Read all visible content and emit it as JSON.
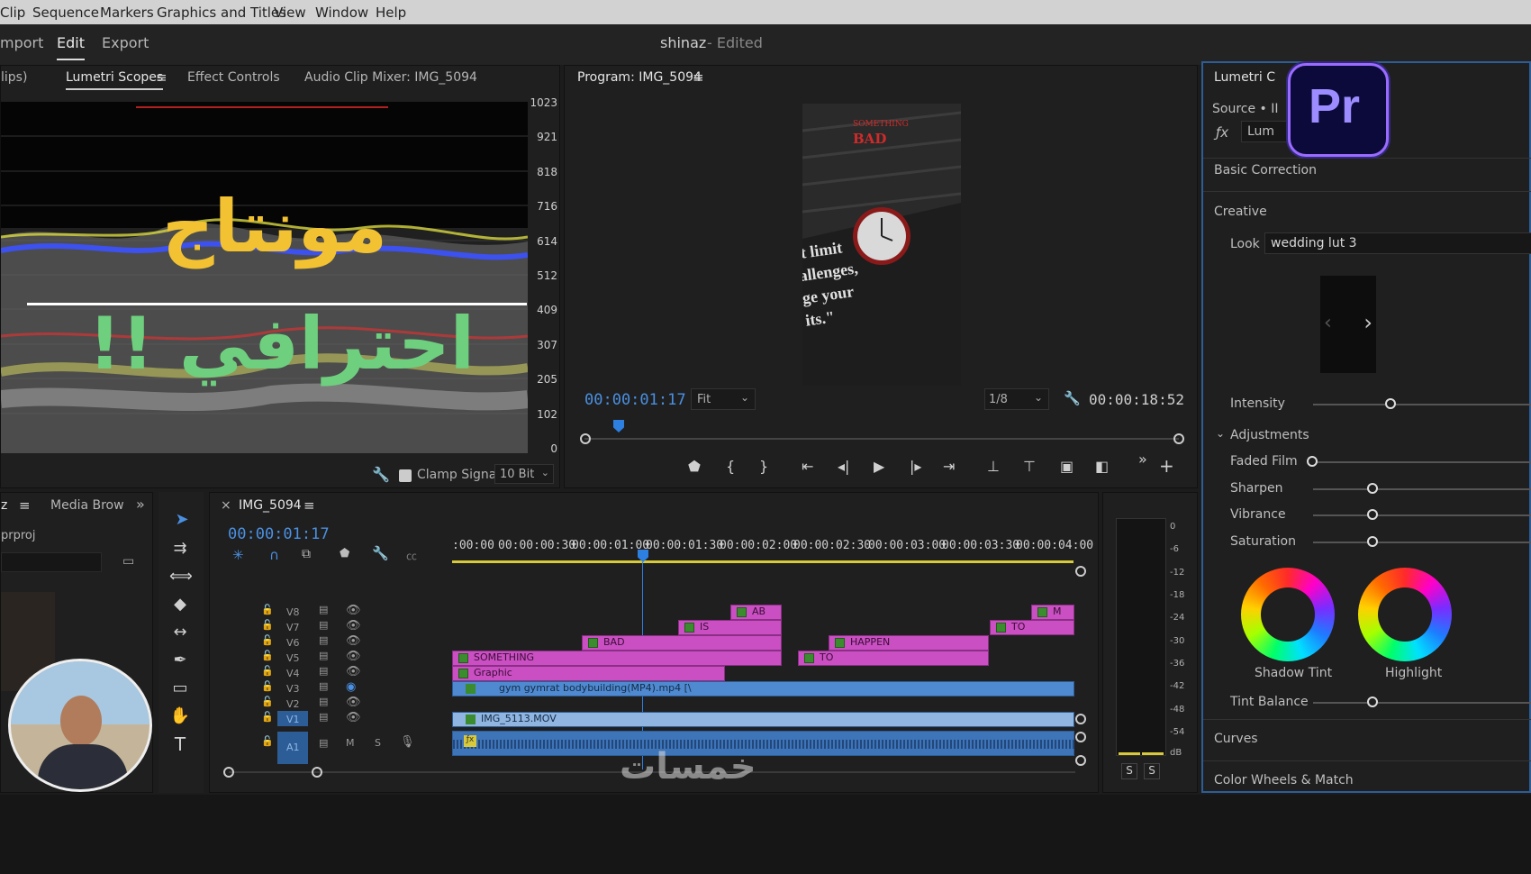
{
  "menu": [
    "Clip",
    "Sequence",
    "Markers",
    "Graphics and Titles",
    "View",
    "Window",
    "Help"
  ],
  "workspace": {
    "import": "mport",
    "edit": "Edit",
    "export": "Export",
    "project": "shinaz",
    "status": "- Edited"
  },
  "scopes": {
    "tabs": [
      "lips)",
      "Lumetri Scopes",
      "Effect Controls",
      "Audio Clip Mixer: IMG_5094"
    ],
    "scale": [
      "1023",
      "921",
      "818",
      "716",
      "614",
      "512",
      "409",
      "307",
      "205",
      "102",
      "0"
    ],
    "clamp": "Clamp Signal",
    "bitdepth": "10 Bit"
  },
  "overlay": {
    "line1": "مونتاج",
    "line2": "احترافي !!"
  },
  "program": {
    "title": "Program: IMG_5094",
    "timecode": "00:00:01:17",
    "fit": "Fit",
    "resolution": "1/8",
    "duration": "00:00:18:52",
    "video_text_small": "SOMETHING",
    "video_text_big": "BAD",
    "video_quote": "'t limit allenges, ge your its.\""
  },
  "lumetri": {
    "title": "Lumetri C",
    "source": "Source • II",
    "fx_label": "Lum",
    "basic": "Basic Correction",
    "creative": "Creative",
    "look_label": "Look",
    "look_value": "wedding lut 3",
    "intensity": "Intensity",
    "adjustments": "Adjustments",
    "faded": "Faded Film",
    "sharpen": "Sharpen",
    "vibrance": "Vibrance",
    "saturation": "Saturation",
    "shadow": "Shadow Tint",
    "highlight": "Highlight",
    "tint_balance": "Tint Balance",
    "curves": "Curves",
    "wheels": "Color Wheels & Match"
  },
  "project": {
    "tab1": "z",
    "tab2": "Media Brow",
    "file": "prproj"
  },
  "timeline": {
    "name": "IMG_5094",
    "timecode": "00:00:01:17",
    "ruler": [
      ":00:00",
      "00:00:00:30",
      "00:00:01:00",
      "00:00:01:30",
      "00:00:02:00",
      "00:00:02:30",
      "00:00:03:00",
      "00:00:03:30",
      "00:00:04:00"
    ],
    "tracks": [
      "V8",
      "V7",
      "V6",
      "V5",
      "V4",
      "V3",
      "V2",
      "V1",
      "A1"
    ],
    "clips": {
      "ab": "AB",
      "m": "M",
      "is": "IS",
      "to1": "TO",
      "bad": "BAD",
      "happen": "HAPPEN",
      "something": "SOMETHING",
      "to2": "TO",
      "graphic": "Graphic",
      "gym": "gym  gymrat  bodybuilding(MP4).mp4 [\\",
      "img": "IMG_5113.MOV"
    },
    "a1_m": "M",
    "a1_s": "S"
  },
  "meter": {
    "scale": [
      "0",
      "-6",
      "-12",
      "-18",
      "-24",
      "-30",
      "-36",
      "-42",
      "-48",
      "-54",
      "dB"
    ],
    "s1": "S",
    "s2": "S"
  },
  "watermark": "خمسات",
  "pr_logo": "Pr"
}
